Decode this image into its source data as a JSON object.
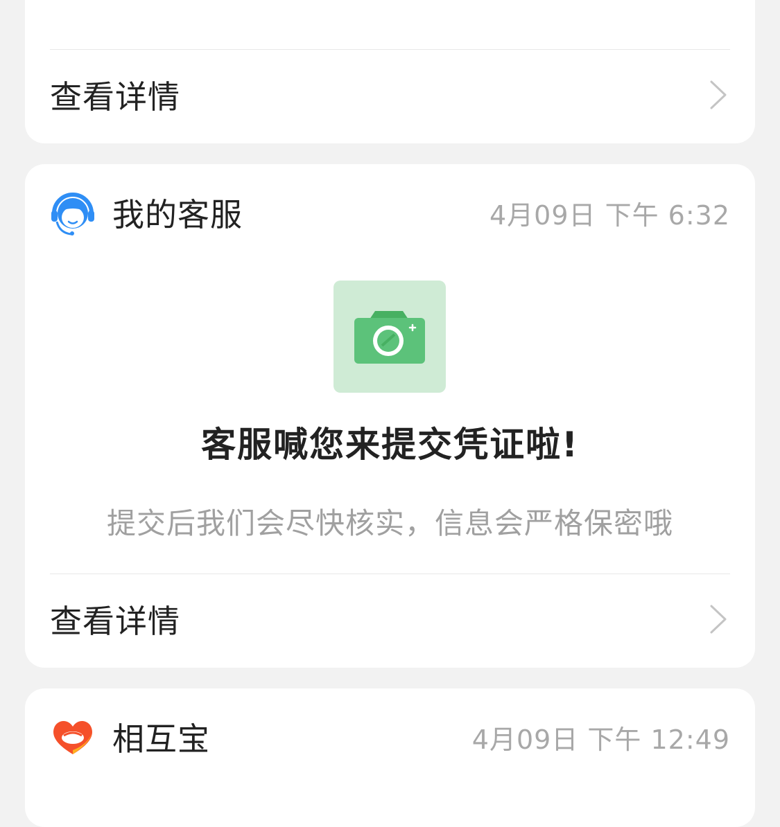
{
  "top_card": {
    "details_label": "查看详情"
  },
  "service_card": {
    "sender": "我的客服",
    "timestamp": "4月09日 下午 6:32",
    "headline": "客服喊您来提交凭证啦!",
    "subtext": "提交后我们会尽快核实，信息会严格保密哦",
    "details_label": "查看详情",
    "avatar_icon": "customer-service-icon",
    "image_icon": "camera-icon"
  },
  "mutual_card": {
    "sender": "相互宝",
    "timestamp": "4月09日 下午 12:49",
    "avatar_icon": "xianghubao-logo-icon"
  },
  "colors": {
    "service_blue": "#2f8ef5",
    "camera_green": "#5cc27a",
    "camera_tile": "#cfebd5",
    "logo_orange": "#f5502a",
    "logo_yellow": "#ffb020"
  }
}
